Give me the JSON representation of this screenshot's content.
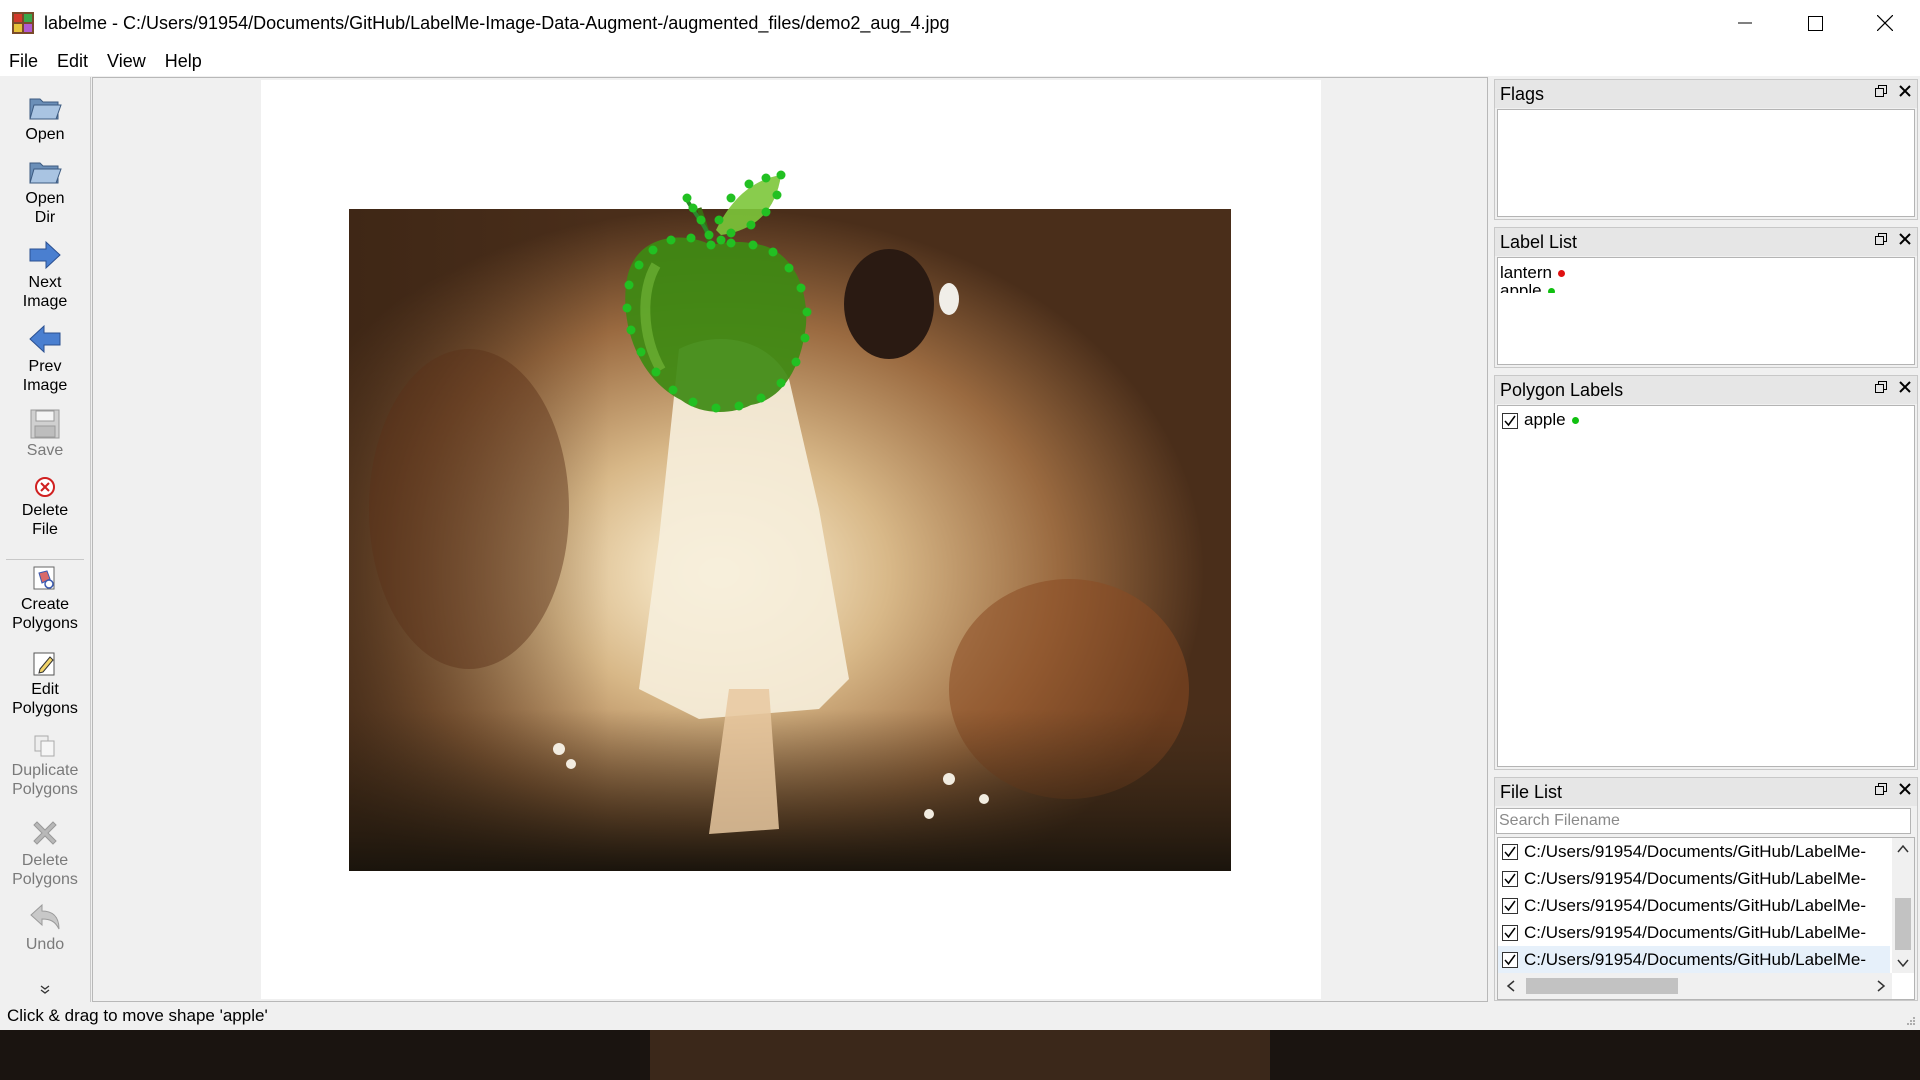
{
  "window": {
    "title": "labelme - C:/Users/91954/Documents/GitHub/LabelMe-Image-Data-Augment-/augmented_files/demo2_aug_4.jpg",
    "app_icon": "labelme-icon"
  },
  "menu": [
    "File",
    "Edit",
    "View",
    "Help"
  ],
  "toolbar": {
    "open": "Open",
    "open_dir": "Open\nDir",
    "next_image": "Next\nImage",
    "prev_image": "Prev\nImage",
    "save": "Save",
    "delete_file": "Delete\nFile",
    "create_polygons": "Create\nPolygons",
    "edit_polygons": "Edit\nPolygons",
    "duplicate_polygons": "Duplicate\nPolygons",
    "delete_polygons": "Delete\nPolygons",
    "undo": "Undo"
  },
  "docks": {
    "flags": {
      "title": "Flags"
    },
    "label_list": {
      "title": "Label List",
      "items": [
        {
          "label": "lantern",
          "color": "#e01010"
        },
        {
          "label": "apple",
          "color": "#10c010"
        }
      ]
    },
    "polygon_labels": {
      "title": "Polygon Labels",
      "items": [
        {
          "label": "apple",
          "color": "#10c010",
          "checked": true
        }
      ]
    },
    "file_list": {
      "title": "File List",
      "search_placeholder": "Search Filename",
      "items": [
        "C:/Users/91954/Documents/GitHub/LabelMe-",
        "C:/Users/91954/Documents/GitHub/LabelMe-",
        "C:/Users/91954/Documents/GitHub/LabelMe-",
        "C:/Users/91954/Documents/GitHub/LabelMe-",
        "C:/Users/91954/Documents/GitHub/LabelMe-"
      ]
    }
  },
  "canvas": {
    "shape_label": "apple",
    "shape_color": "#22c022"
  },
  "status": "Click & drag to move shape 'apple'",
  "colors": {
    "window_bg": "#f0f0f0",
    "polygon_vertex": "#22c022",
    "lantern": "#e01010",
    "apple": "#10c010"
  }
}
